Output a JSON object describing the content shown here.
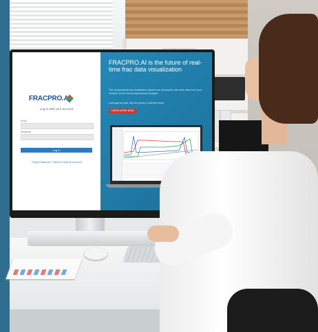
{
  "monitor_screen": {
    "logo_text": "FRACPRO.AI",
    "login": {
      "subtitle": "Log in with your account",
      "email_label": "Email",
      "password_label": "Password",
      "login_button": "Log In",
      "forgot_link": "Forgot Password?",
      "separator": "|",
      "setup_link": "Need to setup an account?"
    },
    "promo": {
      "headline": "FRACPRO.AI is the future of real-time frac data visualization",
      "description": "The most powerful frac visualization system ever developed, with more data, from more sources, for the most comprehensive analysis.",
      "tagline": "Leverage the past. See the present. Build the future.",
      "cta_button": "LEARN MORE NOW"
    }
  },
  "chart_lines": {
    "colors": [
      "#2a6ccc",
      "#d9342b",
      "#2aa05a",
      "#7a7a7a"
    ]
  }
}
